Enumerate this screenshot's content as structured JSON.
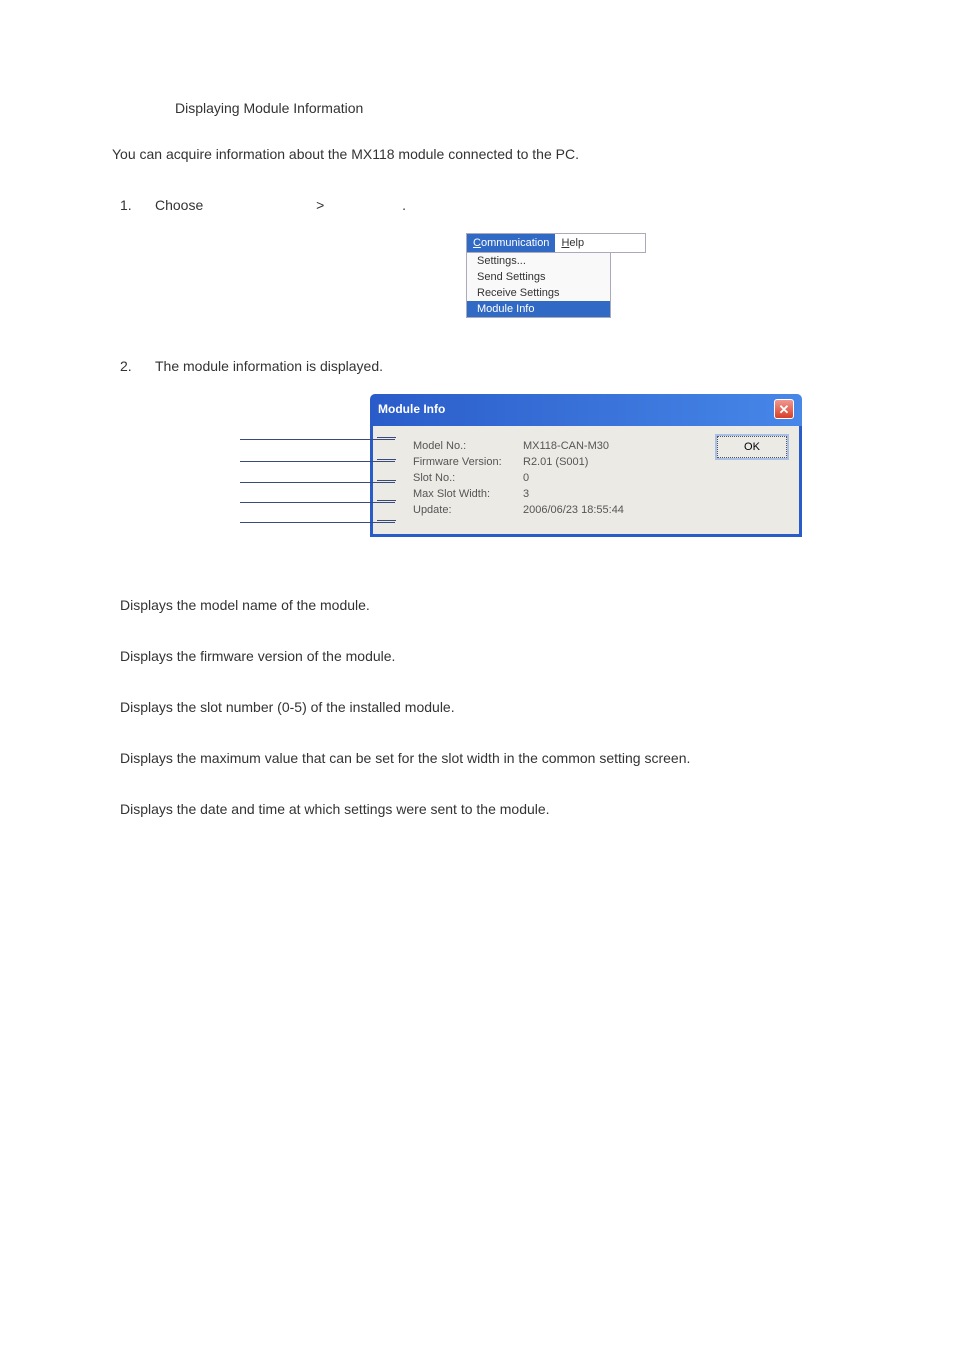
{
  "title": "Displaying Module Information",
  "intro": "You can acquire information about the MX118 module connected to the PC.",
  "step1": {
    "num": "1.",
    "text_prefix": "Choose",
    "text_separator": ">",
    "text_suffix": "."
  },
  "step2": {
    "num": "2.",
    "text": "The module information is displayed."
  },
  "menu": {
    "communication": "Communication",
    "help": "Help",
    "items": [
      "Settings...",
      "Send Settings",
      "Receive Settings",
      "Module Info"
    ]
  },
  "dialog": {
    "title": "Module Info",
    "ok": "OK",
    "rows": [
      {
        "label": "Model No.:",
        "value": "MX118-CAN-M30"
      },
      {
        "label": "Firmware Version:",
        "value": "R2.01 (S001)"
      },
      {
        "label": "Slot No.:",
        "value": "0"
      },
      {
        "label": "Max Slot Width:",
        "value": "3"
      },
      {
        "label": "Update:",
        "value": "2006/06/23  18:55:44"
      }
    ]
  },
  "descriptions": [
    "Displays the model name of the module.",
    "Displays the firmware version of the module.",
    "Displays the slot number (0-5) of the installed module.",
    "Displays the maximum value that can be set for the slot width in the common setting screen.",
    "Displays the date and time at which settings were sent to the module."
  ]
}
